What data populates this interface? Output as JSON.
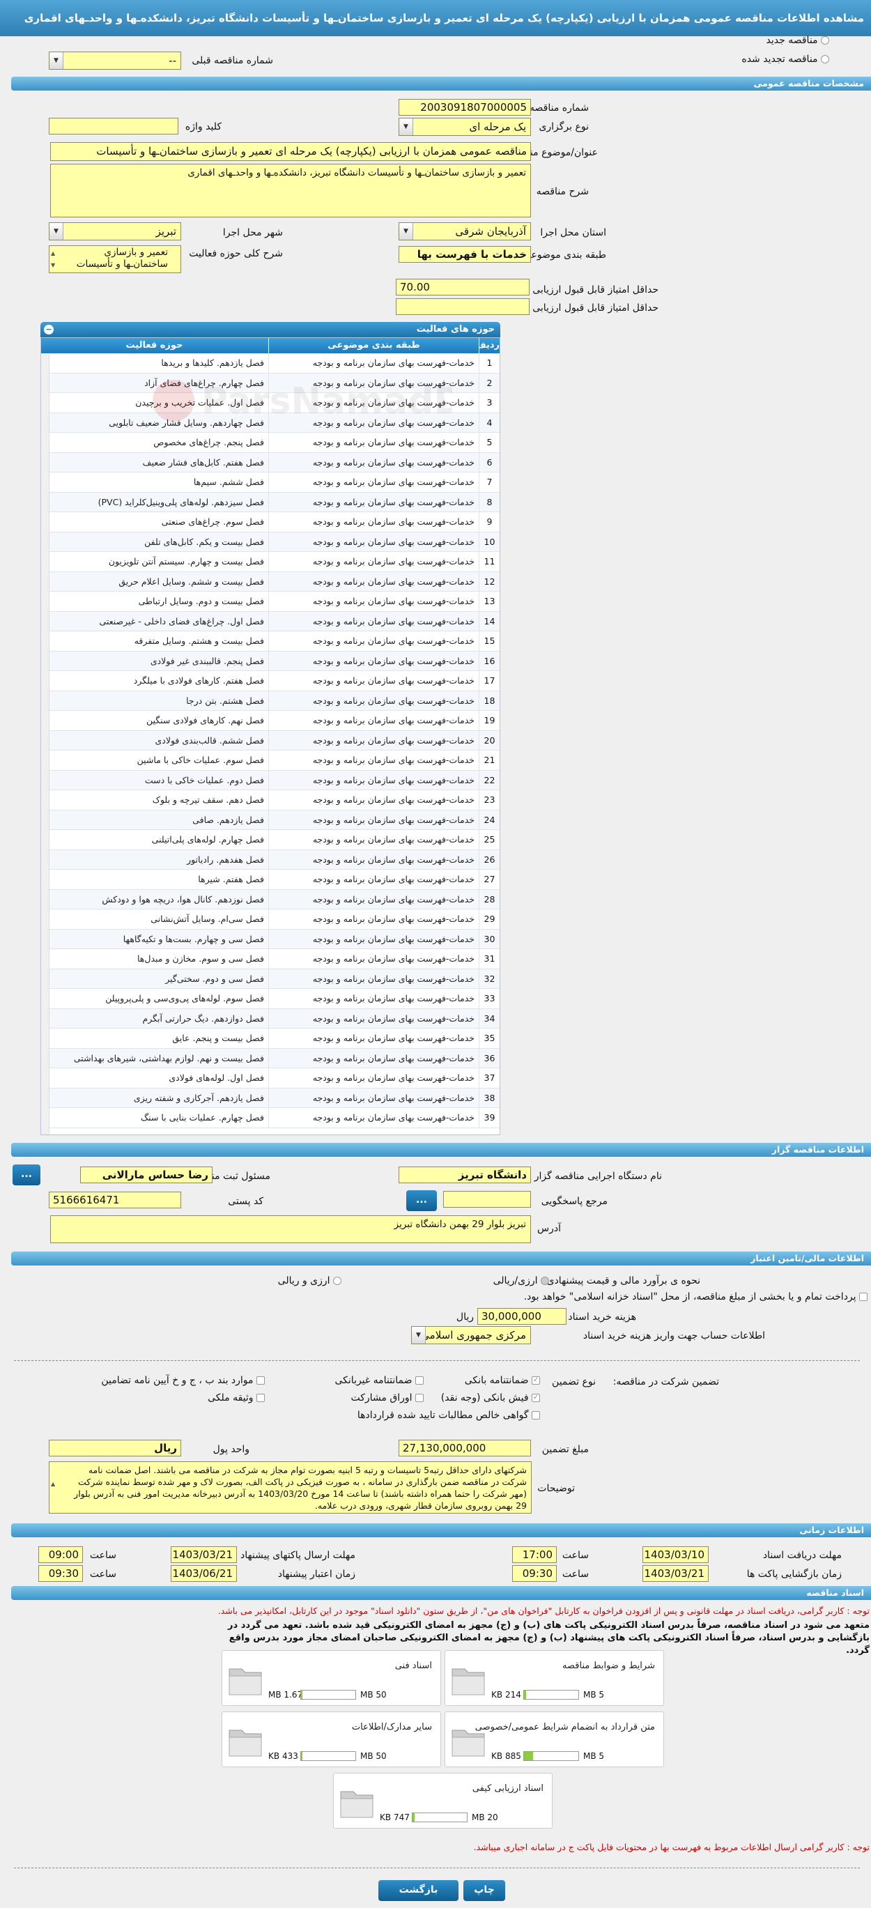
{
  "title": "مشاهده اطلاعات مناقصه عمومی همزمان با ارزیابی (یکپارچه) یک مرحله ای تعمیر و بازسازی ساختمان‌ـها و تأسیسات دانشگاه تبریز، دانشکده‌ـها و واحد‌ـهای اقماری",
  "top": {
    "new_tender": "مناقصه جدید",
    "renewed": "مناقصه تجدید شده",
    "prev_no_label": "شماره مناقصه قبلی",
    "prev_no_value": "--"
  },
  "sections": {
    "general": "مشخصات مناقصه عمومی",
    "activity": "حوزه های فعالیت",
    "organizer": "اطلاعات مناقصه گزار",
    "finance": "اطلاعات مالی/تامین اعتبار",
    "timing": "اطلاعات زمانی",
    "docs": "اسناد مناقصه"
  },
  "general": {
    "no_label": "شماره مناقصه",
    "no_value": "2003091807000005",
    "type_label": "نوع برگزاری",
    "type_value": "یک مرحله ای",
    "keyword_label": "کلید واژه",
    "keyword_value": "",
    "subject_label": "عنوان/موضوع مناقصه",
    "subject_value": "مناقصه عمومی همزمان با ارزیابی (یکپارچه) یک مرحله ای تعمیر و بازسازی ساختمان‌ـها و تأسیسات",
    "desc_label": "شرح مناقصه",
    "desc_value": "تعمیر و بازسازی ساختمان‌ـها و تأسیسات دانشگاه تبریز، دانشکده‌ـها و واحد‌ـهای اقماری",
    "province_label": "استان محل اجرا",
    "province_value": "آذربایجان شرقی",
    "city_label": "شهر محل اجرا",
    "city_value": "تبریز",
    "category_label": "طبقه بندی موضوعی",
    "category_value": "خدمات با فهرست بها",
    "activity_desc_label": "شرح کلی حوزه فعالیت",
    "activity_desc_line1": "تعمیر و بازسازی",
    "activity_desc_line2": "ساختمان‌ـها و تأسیسات",
    "min_quality_label": "حداقل امتیاز قابل قبول ارزیابی کیفی",
    "min_quality_value": "70.00",
    "min_tech_label": "حداقل امتیاز قابل قبول ارزیابی فنی/بازرگانی",
    "min_tech_value": ""
  },
  "activity_table": {
    "headers": {
      "no": "ردیف",
      "category": "طبقه بندی موضوعی",
      "scope": "حوزه فعالیت"
    },
    "rows": [
      {
        "no": "1",
        "category": "خدمات-فهرست بهای سازمان برنامه و بودجه",
        "scope": "فصل یازدهم. کلیدها و بریدها"
      },
      {
        "no": "2",
        "category": "خدمات-فهرست بهای سازمان برنامه و بودجه",
        "scope": "فصل چهارم. چراغ‌های فضای آزاد"
      },
      {
        "no": "3",
        "category": "خدمات-فهرست بهای سازمان برنامه و بودجه",
        "scope": "فصل اول. عملیات تخریب و برچیدن"
      },
      {
        "no": "4",
        "category": "خدمات-فهرست بهای سازمان برنامه و بودجه",
        "scope": "فصل چهاردهم. وسایل فشار ضعیف تابلویی"
      },
      {
        "no": "5",
        "category": "خدمات-فهرست بهای سازمان برنامه و بودجه",
        "scope": "فصل پنجم. چراغ‌های مخصوص"
      },
      {
        "no": "6",
        "category": "خدمات-فهرست بهای سازمان برنامه و بودجه",
        "scope": "فصل هفتم. کابل‌های فشار ضعیف"
      },
      {
        "no": "7",
        "category": "خدمات-فهرست بهای سازمان برنامه و بودجه",
        "scope": "فصل ششم. سیم‌ها"
      },
      {
        "no": "8",
        "category": "خدمات-فهرست بهای سازمان برنامه و بودجه",
        "scope": "فصل سیزدهم. لوله‌های پلی‌وینیل‌کلراید (PVC)"
      },
      {
        "no": "9",
        "category": "خدمات-فهرست بهای سازمان برنامه و بودجه",
        "scope": "فصل سوم. چراغ‌های صنعتی"
      },
      {
        "no": "10",
        "category": "خدمات-فهرست بهای سازمان برنامه و بودجه",
        "scope": "فصل بیست و یکم. کابل‌های تلفن"
      },
      {
        "no": "11",
        "category": "خدمات-فهرست بهای سازمان برنامه و بودجه",
        "scope": "فصل بیست و چهارم. سیستم آنتن تلویزیون"
      },
      {
        "no": "12",
        "category": "خدمات-فهرست بهای سازمان برنامه و بودجه",
        "scope": "فصل بیست و ششم. وسایل اعلام حریق"
      },
      {
        "no": "13",
        "category": "خدمات-فهرست بهای سازمان برنامه و بودجه",
        "scope": "فصل بیست و دوم. وسایل ارتباطی"
      },
      {
        "no": "14",
        "category": "خدمات-فهرست بهای سازمان برنامه و بودجه",
        "scope": "فصل اول. چراغ‌های فضای داخلی - غیرصنعتی"
      },
      {
        "no": "15",
        "category": "خدمات-فهرست بهای سازمان برنامه و بودجه",
        "scope": "فصل بیست و هشتم. وسایل متفرقه"
      },
      {
        "no": "16",
        "category": "خدمات-فهرست بهای سازمان برنامه و بودجه",
        "scope": "فصل پنجم. قالببندی غیر فولادی"
      },
      {
        "no": "17",
        "category": "خدمات-فهرست بهای سازمان برنامه و بودجه",
        "scope": "فصل هفتم. کارهای فولادی با میلگرد"
      },
      {
        "no": "18",
        "category": "خدمات-فهرست بهای سازمان برنامه و بودجه",
        "scope": "فصل هشتم. بتن درجا"
      },
      {
        "no": "19",
        "category": "خدمات-فهرست بهای سازمان برنامه و بودجه",
        "scope": "فصل نهم. کارهای فولادی سنگین"
      },
      {
        "no": "20",
        "category": "خدمات-فهرست بهای سازمان برنامه و بودجه",
        "scope": "فصل ششم. قالب‌بندی فولادی"
      },
      {
        "no": "21",
        "category": "خدمات-فهرست بهای سازمان برنامه و بودجه",
        "scope": "فصل سوم. عملیات خاکی با ماشین"
      },
      {
        "no": "22",
        "category": "خدمات-فهرست بهای سازمان برنامه و بودجه",
        "scope": "فصل دوم. عملیات خاکی با دست"
      },
      {
        "no": "23",
        "category": "خدمات-فهرست بهای سازمان برنامه و بودجه",
        "scope": "فصل دهم. سقف تیرچه و بلوک"
      },
      {
        "no": "24",
        "category": "خدمات-فهرست بهای سازمان برنامه و بودجه",
        "scope": "فصل یازدهم. صافی"
      },
      {
        "no": "25",
        "category": "خدمات-فهرست بهای سازمان برنامه و بودجه",
        "scope": "فصل چهارم. لوله‌های پلی‌اتیلنی"
      },
      {
        "no": "26",
        "category": "خدمات-فهرست بهای سازمان برنامه و بودجه",
        "scope": "فصل هفدهم. رادیاتور"
      },
      {
        "no": "27",
        "category": "خدمات-فهرست بهای سازمان برنامه و بودجه",
        "scope": "فصل هفتم. شیرها"
      },
      {
        "no": "28",
        "category": "خدمات-فهرست بهای سازمان برنامه و بودجه",
        "scope": "فصل نوزدهم. کانال هوا، دریچه هوا و دودکش"
      },
      {
        "no": "29",
        "category": "خدمات-فهرست بهای سازمان برنامه و بودجه",
        "scope": "فصل سی‌ام. وسایل آتش‌نشانی"
      },
      {
        "no": "30",
        "category": "خدمات-فهرست بهای سازمان برنامه و بودجه",
        "scope": "فصل سی و چهارم. بست‌ها و تکیه‌گاهها"
      },
      {
        "no": "31",
        "category": "خدمات-فهرست بهای سازمان برنامه و بودجه",
        "scope": "فصل سی و سوم. مخازن و مبدل‌ها"
      },
      {
        "no": "32",
        "category": "خدمات-فهرست بهای سازمان برنامه و بودجه",
        "scope": "فصل سی و دوم. سختی‌گیر"
      },
      {
        "no": "33",
        "category": "خدمات-فهرست بهای سازمان برنامه و بودجه",
        "scope": "فصل سوم. لوله‌های پی‌وی‌سی و پلی‌پروپیلن"
      },
      {
        "no": "34",
        "category": "خدمات-فهرست بهای سازمان برنامه و بودجه",
        "scope": "فصل دوازدهم. دیگ حرارتی آبگرم"
      },
      {
        "no": "35",
        "category": "خدمات-فهرست بهای سازمان برنامه و بودجه",
        "scope": "فصل بیست و پنجم. عایق"
      },
      {
        "no": "36",
        "category": "خدمات-فهرست بهای سازمان برنامه و بودجه",
        "scope": "فصل بیست و نهم. لوازم بهداشتی، شیرهای بهداشتی"
      },
      {
        "no": "37",
        "category": "خدمات-فهرست بهای سازمان برنامه و بودجه",
        "scope": "فصل اول. لوله‌های فولادی"
      },
      {
        "no": "38",
        "category": "خدمات-فهرست بهای سازمان برنامه و بودجه",
        "scope": "فصل یازدهم. آجرکاری و شفته ریزی"
      },
      {
        "no": "39",
        "category": "خدمات-فهرست بهای سازمان برنامه و بودجه",
        "scope": "فصل چهارم. عملیات بنایی با سنگ"
      }
    ]
  },
  "organizer": {
    "org_label": "نام دستگاه اجرایی مناقصه گزار",
    "org_value": "دانشگاه تبریز",
    "resp_label": "مسئول ثبت مناقصه",
    "resp_value": "رضا حساس مارالانی",
    "ref_label": "مرجع پاسخگویی",
    "ref_value": "",
    "postal_label": "کد پستی",
    "postal_value": "5166616471",
    "addr_label": "آدرس",
    "addr_value": "تبریز بلوار 29  بهمن دانشگاه تبریز",
    "more_btn": "..."
  },
  "finance": {
    "estimate_label": "نحوه ی برآورد مالی و قیمت پیشنهادی",
    "opt_rial": "ارزی/ریالی",
    "opt_currency": "ارزی و ریالی",
    "note": "پرداخت تمام و یا بخشی از مبلغ مناقصه، از محل \"اسناد خزانه اسلامی\" خواهد بود.",
    "fee_label": "هزینه خرید اسناد",
    "fee_value": "30,000,000",
    "fee_unit": "ریال",
    "account_label": "اطلاعات حساب جهت واریز هزینه خرید اسناد",
    "account_value": "مرکزی جمهوری اسلامی ایر",
    "guarantee_label": "تضمین شرکت در مناقصه:",
    "type_label": "نوع تضمین",
    "g_bank": "ضمانتنامه بانکی",
    "g_nonbank": "ضمانتنامه غیربانکی",
    "g_clauses": "موارد بند ب ، ج و خ آیین نامه تضامین",
    "g_cheque": "فیش بانکی (وجه نقد)",
    "g_bonds": "اوراق مشارکت",
    "g_property": "وثیقه ملکی",
    "g_cert": "گواهی خالص مطالبات تایید شده قراردادها",
    "amount_label": "مبلغ تضمین",
    "amount_value": "27,130,000,000",
    "currency_label": "واحد پول",
    "currency_value": "ریال",
    "explain_label": "توضیحات",
    "explain_value": "شرکتهای دارای حداقل رتبه5 تاسیسات و رتبه 5 ابنیه بصورت توام مجاز به شرکت در مناقصه می باشند. اصل ضمانت نامه شرکت در مناقصه ضمن بارگذاری در سامانه ، به صورت فیزیکی در پاکت الف، بصورت لاک و مهر شده توسط نماینده شرکت (مهر شرکت را حتما همراه داشته باشند) تا ساعت 14 مورخ 1403/03/20 به آدرس دبیرخانه مدیریت امور فنی به آدرس بلوار 29 بهمن روبروی سازمان قطار شهری، ورودی درب علامه."
  },
  "timing": {
    "receive_label": "مهلت دریافت اسناد",
    "receive_date": "1403/03/10",
    "receive_time": "17:00",
    "send_label": "مهلت ارسال پاکتهای پیشنهاد",
    "send_date": "1403/03/21",
    "send_time": "09:00",
    "open_label": "زمان بازگشایی پاکت ها",
    "open_date": "1403/03/21",
    "open_time": "09:30",
    "valid_label": "زمان اعتبار پیشنهاد",
    "valid_date": "1403/06/21",
    "valid_time": "09:30",
    "time_label": "ساعت"
  },
  "docs": {
    "note_red": "توجه : کاربر گرامی، دریافت اسناد در مهلت قانونی و پس از افزودن فراخوان به کارتابل \"فراخوان های من\"، از طریق ستون \"دانلود اسناد\" موجود در این کارتابل، امکانپذیر می باشد.",
    "note_bold": "متعهد می شود در اسناد مناقصه، صرفاً بدرس اسناد الکترونیکی پاکت های (ب) و (ج) مجهز به امضای الکترونیکی قید شده باشد. تعهد می گردد در بازگشایی و بدرس اسناد، صرفاً اسناد الکترونیکی پاکت های پیشنهاد (ب) و (ج) مجهز به امضای الکترونیکی صاحبان امضای مجاز مورد بدرس واقع گردد.",
    "files": [
      {
        "title": "شرایط و ضوابط مناقصه",
        "size": "214 KB",
        "max": "5 MB",
        "pct": 0.04
      },
      {
        "title": "اسناد فنی",
        "size": "1.67 MB",
        "max": "50 MB",
        "pct": 0.03
      },
      {
        "title": "متن قرارداد به انضمام شرایط عمومی/خصوصی",
        "size": "885 KB",
        "max": "5 MB",
        "pct": 0.17
      },
      {
        "title": "سایر مدارک/اطلاعات",
        "size": "433 KB",
        "max": "50 MB",
        "pct": 0.01
      },
      {
        "title": "اسناد ارزیابی کیفی",
        "size": "747 KB",
        "max": "20 MB",
        "pct": 0.04
      }
    ],
    "note_bottom": "توجه : کاربر گرامی ارسال اطلاعات مربوط به فهرست بها در محتویات فایل پاکت ج در سامانه اجباری میباشد."
  },
  "buttons": {
    "print": "چاپ",
    "back": "بازگشت"
  },
  "watermark": "ParsNamadData"
}
